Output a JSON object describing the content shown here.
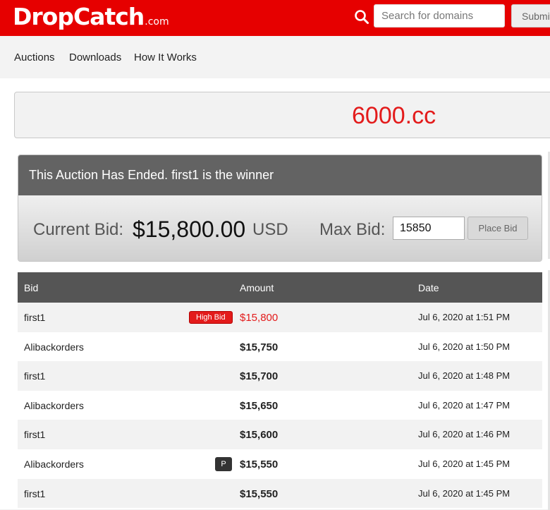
{
  "header": {
    "logo_text": "DropCatch",
    "logo_tld": ".com",
    "search_placeholder": "Search for domains",
    "submit_label": "Submit",
    "brand_color": "#e60000"
  },
  "nav": {
    "items": [
      {
        "label": "Auctions"
      },
      {
        "label": "Downloads"
      },
      {
        "label": "How It Works"
      }
    ]
  },
  "domain": {
    "name": "6000.cc"
  },
  "auction": {
    "status_message": "This Auction Has Ended. first1 is the winner",
    "current_bid_label": "Current Bid:",
    "current_bid_value": "$15,800.00",
    "current_bid_currency": "USD",
    "max_bid_label": "Max Bid:",
    "max_bid_value": "15850",
    "place_bid_label": "Place Bid"
  },
  "bids_table": {
    "columns": [
      "Bid",
      "Amount",
      "Date"
    ],
    "rows": [
      {
        "bidder": "first1",
        "badge": "High Bid",
        "amount": "$15,800",
        "date": "Jul 6, 2020 at 1:51 PM"
      },
      {
        "bidder": "Alibackorders",
        "badge": "",
        "amount": "$15,750",
        "date": "Jul 6, 2020 at 1:50 PM"
      },
      {
        "bidder": "first1",
        "badge": "",
        "amount": "$15,700",
        "date": "Jul 6, 2020 at 1:48 PM"
      },
      {
        "bidder": "Alibackorders",
        "badge": "",
        "amount": "$15,650",
        "date": "Jul 6, 2020 at 1:47 PM"
      },
      {
        "bidder": "first1",
        "badge": "",
        "amount": "$15,600",
        "date": "Jul 6, 2020 at 1:46 PM"
      },
      {
        "bidder": "Alibackorders",
        "badge": "P",
        "amount": "$15,550",
        "date": "Jul 6, 2020 at 1:45 PM"
      },
      {
        "bidder": "first1",
        "badge": "",
        "amount": "$15,550",
        "date": "Jul 6, 2020 at 1:45 PM"
      }
    ]
  },
  "icons": {
    "search": "search-icon"
  },
  "colors": {
    "accent": "#e31b1b",
    "table_header": "#555555",
    "status_bar": "#636363"
  }
}
